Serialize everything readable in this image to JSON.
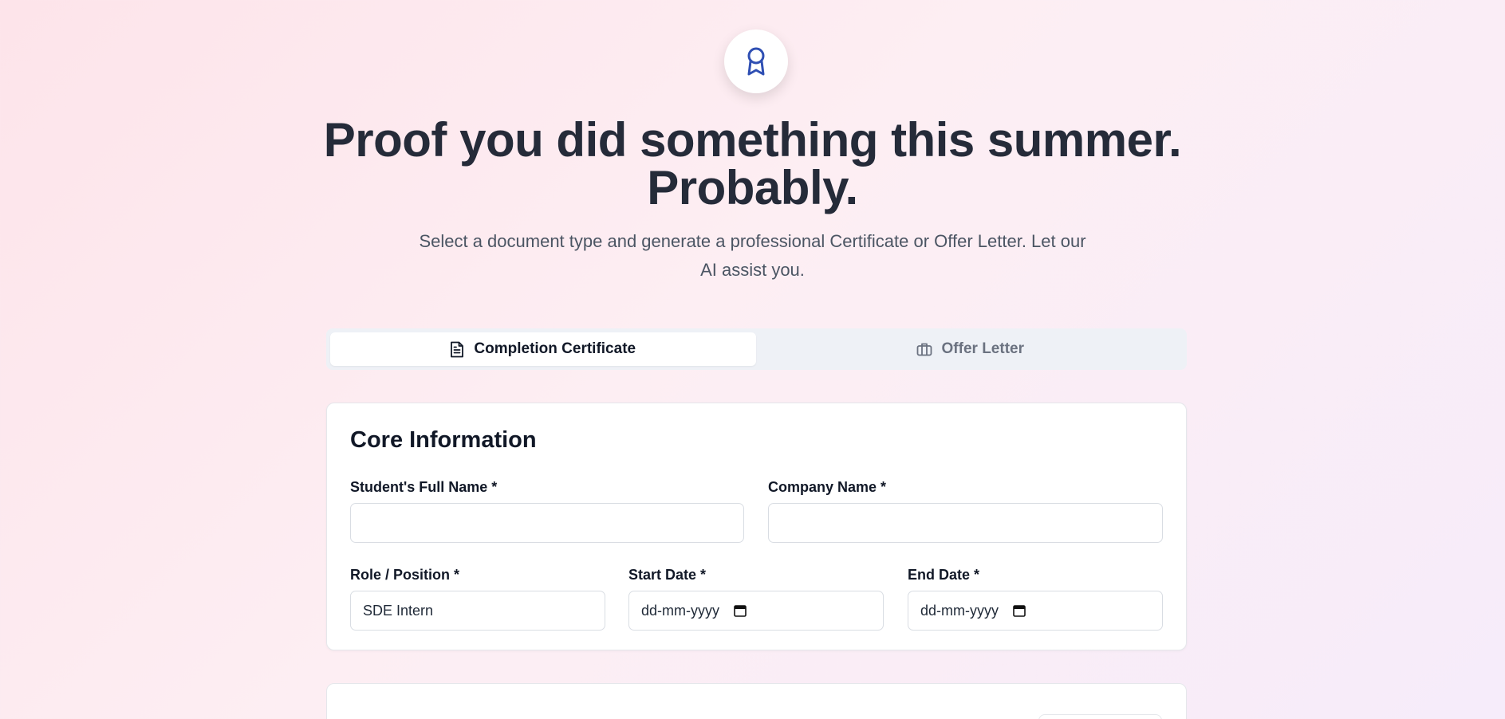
{
  "header": {
    "badge_icon": "award-ribbon-icon",
    "headline_line1": "Proof you did something this summer.",
    "headline_line2": "Probably.",
    "subtitle": "Select a document type and generate a professional Certificate or Offer Letter. Let our AI assist you."
  },
  "tabs": [
    {
      "label": "Completion Certificate",
      "icon": "document-icon",
      "active": true
    },
    {
      "label": "Offer Letter",
      "icon": "briefcase-icon",
      "active": false
    }
  ],
  "core_info": {
    "title": "Core Information",
    "student_name": {
      "label": "Student's Full Name *",
      "value": ""
    },
    "company_name": {
      "label": "Company Name *",
      "value": ""
    },
    "role": {
      "label": "Role / Position *",
      "value": "SDE Intern"
    },
    "start_date": {
      "label": "Start Date *",
      "placeholder": "dd-mm-yyyy"
    },
    "end_date": {
      "label": "End Date *",
      "placeholder": "dd-mm-yyyy"
    }
  },
  "colors": {
    "accent": "#2f4fb3",
    "headline": "#252b39"
  }
}
